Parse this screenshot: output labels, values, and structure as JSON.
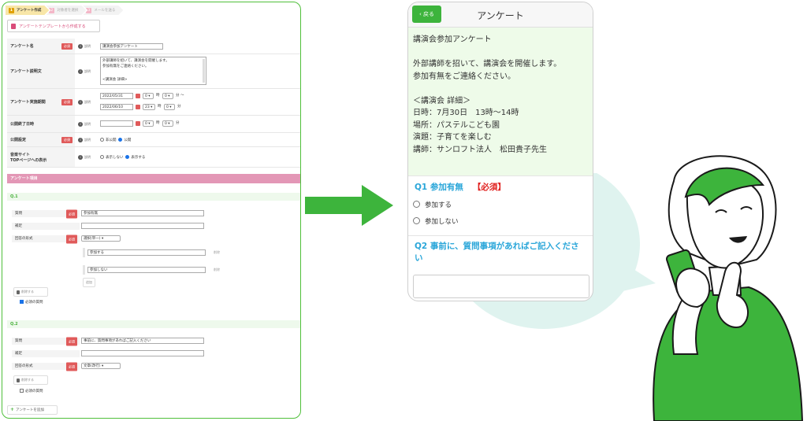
{
  "admin": {
    "steps": [
      {
        "num": "1",
        "label": "アンケート作成"
      },
      {
        "num": "2",
        "label": "対象者を選択"
      },
      {
        "num": "3",
        "label": "メールを送る"
      }
    ],
    "template_button": "アンケートテンプレートから作成する",
    "help_label": "説明",
    "required_label": "必須",
    "fields": {
      "name": {
        "label": "アンケート名",
        "value": "講演会参加アンケート"
      },
      "description": {
        "label": "アンケート説明文",
        "lines": [
          "外部講師を招いて、講演会を開催します。",
          "参加有無をご連絡ください。",
          "",
          "<講演会 詳細>"
        ]
      },
      "period": {
        "label": "アンケート実施期間",
        "start_date": "2022/05/31",
        "start_hour": "0",
        "start_min": "0",
        "end_date": "2022/06/10",
        "end_hour": "23",
        "end_min": "0",
        "hour_unit": "時",
        "min_unit": "分",
        "tilde": "〜"
      },
      "public_end": {
        "label": "公開終了日時",
        "hour": "0",
        "min": "0"
      },
      "public_setting": {
        "label": "公開設定",
        "opt1": "非公開",
        "opt2": "公開"
      },
      "top_display": {
        "label1": "音楽サイト",
        "label2": "TOPページへの表示",
        "opt1": "表示しない",
        "opt2": "表示する"
      }
    },
    "section_title": "アンケート項目",
    "questions": [
      {
        "head": "Q.1",
        "q_label": "質問",
        "q_value": "参加有無",
        "note_label": "補足",
        "format_label": "回答の形式",
        "format_value": "選択(単一)",
        "options": [
          "参加する",
          "参加しない"
        ],
        "delete_opt": "削除",
        "add_opt": "追加",
        "delete_btn": "削除する",
        "required_chk": "必須の質問"
      },
      {
        "head": "Q.2",
        "q_label": "質問",
        "q_value": "事前に、質問事項があればご記入ください",
        "note_label": "補足",
        "format_label": "回答の形式",
        "format_value": "文章(改行)",
        "delete_btn": "削除する",
        "required_chk": "必須の質問"
      }
    ],
    "add_survey": "アンケートを追加"
  },
  "phone": {
    "back": "‹ 戻る",
    "title": "アンケート",
    "desc_lines": [
      "講演会参加アンケート",
      "",
      "外部講師を招いて、講演会を開催します。",
      "参加有無をご連絡ください。",
      "",
      "",
      "＜講演会 詳細＞",
      "日時：7月30日　13時〜14時",
      "場所：パステルこども園",
      "演題：子育てを楽しむ",
      "講師：サンロフト法人　松田貴子先生"
    ],
    "q1": "Q1 参加有無",
    "q1_required": "【必須】",
    "q1_options": [
      "参加する",
      "参加しない"
    ],
    "q2_line1": "Q2 事前に、質問事項があればご記入くださ",
    "q2_line2": "い"
  },
  "colors": {
    "green": "#3db43c",
    "pink": "#e397b6",
    "question_blue": "#2aa6d9",
    "required_red": "#e0201e"
  }
}
